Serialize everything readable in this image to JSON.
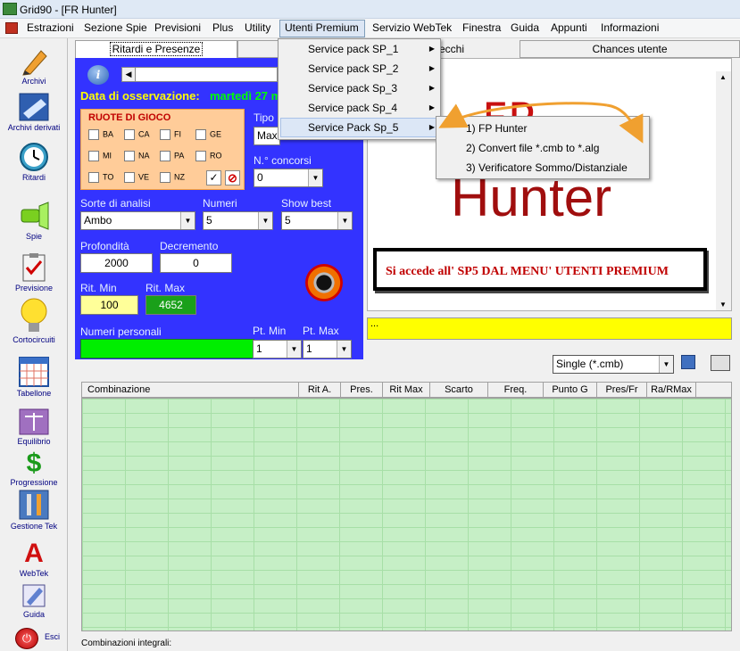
{
  "window": {
    "title": "Grid90 - [FR Hunter]"
  },
  "menubar": {
    "items": [
      "Estrazioni",
      "Sezione Spie",
      "Previsioni",
      "Plus",
      "Utility",
      "Utenti Premium",
      "Servizio WebTek",
      "Finestra",
      "Guida",
      "Appunti",
      "Informazioni"
    ],
    "active": "Utenti Premium"
  },
  "dropdown": {
    "items": [
      "Service pack SP_1",
      "Service pack SP_2",
      "Service pack Sp_3",
      "Service pack Sp_4",
      "Service Pack Sp_5"
    ],
    "selected_index": 4
  },
  "submenu": {
    "items": [
      "1) FP Hunter",
      "2) Convert file *.cmb to *.alg",
      "3) Verificatore Sommo/Distanziale"
    ]
  },
  "sidebar": {
    "items": [
      "Archivi",
      "Archivi derivati",
      "Ritardi",
      "Spie",
      "Previsione",
      "Cortocircuiti",
      "Tabellone",
      "Equilibrio",
      "Progressione",
      "Gestione Tek",
      "WebTek",
      "Guida",
      "Esci"
    ]
  },
  "tabs": [
    "Ritardi e Presenze",
    "ecchi",
    "Chances utente"
  ],
  "panel": {
    "obs_label": "Data di osservazione:",
    "obs_value": "martedì 27 m",
    "ruote_title": "RUOTE DI GIOCO",
    "ruote": [
      "BA",
      "CA",
      "FI",
      "GE",
      "MI",
      "NA",
      "PA",
      "RO",
      "TO",
      "VE",
      "NZ"
    ],
    "tipo_label": "Tipo",
    "tipo_value": "Max",
    "concorsi_label": "N.° concorsi",
    "concorsi_value": "0",
    "sorte_label": "Sorte di analisi",
    "sorte_value": "Ambo",
    "numeri_label": "Numeri",
    "numeri_value": "5",
    "showbest_label": "Show best",
    "showbest_value": "5",
    "profondita_label": "Profondità",
    "profondita_value": "2000",
    "decremento_label": "Decremento",
    "decremento_value": "0",
    "ritmin_label": "Rit. Min",
    "ritmin_value": "100",
    "ritmax_label": "Rit. Max",
    "ritmax_value": "4652",
    "numeri_pers_label": "Numeri personali",
    "ptmin_label": "Pt. Min",
    "ptmin_value": "1",
    "ptmax_label": "Pt. Max",
    "ptmax_value": "1"
  },
  "logo": {
    "line1": "FP",
    "line2": "Hunter"
  },
  "annotation": "Si accede all' SP5 DAL MENU' UTENTI PREMIUM",
  "yellow_bar": "...",
  "file_type": "Single (*.cmb)",
  "grid": {
    "headers": [
      "Combinazione",
      "Rit A.",
      "Pres.",
      "Rit Max",
      "Scarto",
      "Freq.",
      "Punto G",
      "Pres/Fr",
      "Ra/RMax"
    ]
  },
  "footer": "Combinazioni integrali:",
  "colors": {
    "panel_bg": "#3333ff",
    "ruote_bg": "#ffcc99",
    "grid_bg": "#c6efc6",
    "highlight_yellow": "#ffff00",
    "logo_red": "#c81010",
    "annotation_red": "#c00000",
    "arrow_orange": "#f0a030"
  }
}
